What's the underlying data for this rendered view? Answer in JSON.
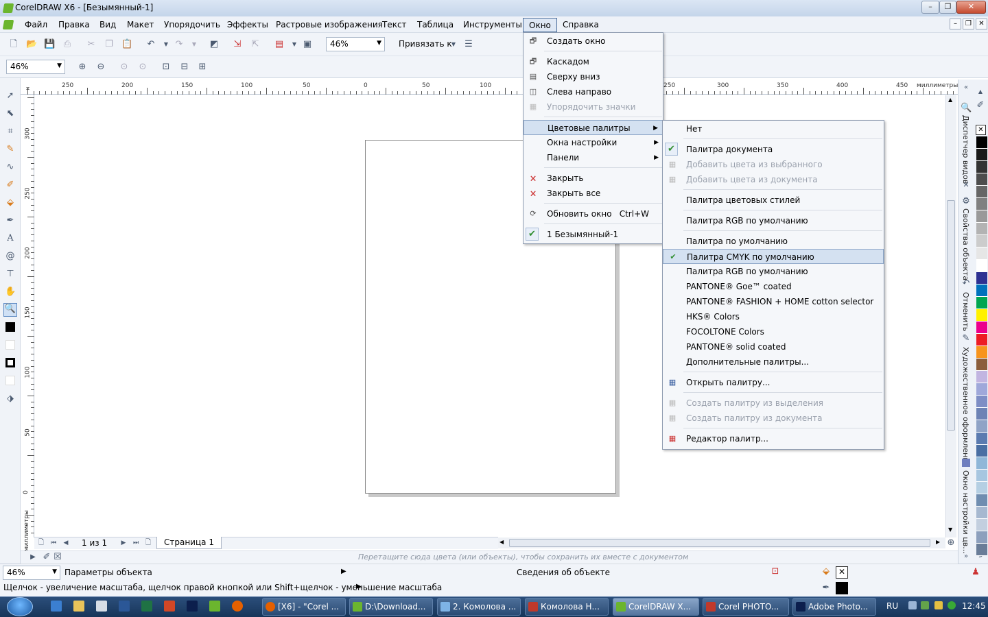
{
  "title": "CorelDRAW X6 - [Безымянный-1]",
  "window_buttons": {
    "min": "▭",
    "max": "▭",
    "close": "✕"
  },
  "menu": [
    "Файл",
    "Правка",
    "Вид",
    "Макет",
    "Упорядочить",
    "Эффекты",
    "Растровые изображения",
    "Текст",
    "Таблица",
    "Инструменты",
    "Окно",
    "Справка"
  ],
  "toolbar": {
    "zoom": "46%",
    "snap": "Привязать к"
  },
  "toolbar2": {
    "zoom": "46%"
  },
  "ruler": {
    "h": [
      "250",
      "200",
      "150",
      "100",
      "50",
      "0",
      "50",
      "100",
      "150",
      "200",
      "250",
      "300",
      "350",
      "400",
      "450"
    ],
    "unit": "миллиметры",
    "v": [
      "300",
      "250",
      "200",
      "150",
      "100",
      "50",
      "0"
    ]
  },
  "window_menu": [
    {
      "label": "Создать окно"
    },
    {
      "label": "Каскадом"
    },
    {
      "label": "Сверху вниз"
    },
    {
      "label": "Слева направо"
    },
    {
      "label": "Упорядочить значки"
    },
    {
      "label": "Цветовые палитры"
    },
    {
      "label": "Окна настройки"
    },
    {
      "label": "Панели"
    },
    {
      "label": "Закрыть"
    },
    {
      "label": "Закрыть все"
    },
    {
      "label": "Обновить окно",
      "shortcut": "Ctrl+W"
    },
    {
      "label": "1 Безымянный-1"
    }
  ],
  "palette_menu": [
    "Нет",
    "Палитра документа",
    "Добавить цвета из выбранного",
    "Добавить цвета из документа",
    "Палитра цветовых стилей",
    "Палитра RGB по умолчанию",
    "Палитра по умолчанию",
    "Палитра CMYK по умолчанию",
    "Палитра RGB по умолчанию",
    "PANTONE® Goe™ coated",
    "PANTONE® FASHION + HOME cotton selector",
    "HKS® Colors",
    "FOCOLTONE Colors",
    "PANTONE® solid coated",
    "Дополнительные палитры...",
    "Открыть палитру...",
    "Создать палитру из выделения",
    "Создать палитру из документа",
    "Редактор палитр..."
  ],
  "pagenav": {
    "count": "1 из 1",
    "tab": "Страница 1"
  },
  "hint": "Перетащите сюда цвета (или объекты), чтобы сохранить их вместе с документом",
  "status": {
    "zoom": "46%",
    "params": "Параметры объекта",
    "info": "Сведения об объекте",
    "help": "Щелчок - увеличение масштаба, щелчок правой кнопкой или Shift+щелчок - уменьшение масштаба"
  },
  "dockers": [
    "Диспетчер видов",
    "Свойства объекта",
    "Отменить",
    "Художественное оформление",
    "Окно настройки цв..."
  ],
  "taskbar": {
    "buttons": [
      "[X6] - \"Corel ...",
      "D:\\Download...",
      "2. Комолова ...",
      "Комолова Н...",
      "CorelDRAW X...",
      "Corel PHOTO...",
      "Adobe Photo..."
    ],
    "lang": "RU",
    "clock": "12:45"
  },
  "colors": {
    "accent": "#2f8e2f",
    "swatches": [
      "#000000",
      "#1a1a1a",
      "#333333",
      "#4d4d4d",
      "#666666",
      "#808080",
      "#999999",
      "#b3b3b3",
      "#cccccc",
      "#e6e6e6",
      "#ffffff",
      "#2e3192",
      "#0072bc",
      "#00a651",
      "#fff200",
      "#ec008c",
      "#ed1c24",
      "#f7941d",
      "#8b5e3c",
      "#c2b5e1",
      "#9fa8da",
      "#7e8ec5",
      "#6d83b5",
      "#8fa3c6",
      "#5b7bb0",
      "#4a6fa3",
      "#8fb7d8",
      "#a7c6e0",
      "#b5cfe3",
      "#6f8db0",
      "#a6b8d0",
      "#c3cfdf",
      "#8da0bd",
      "#6a7d98"
    ]
  }
}
